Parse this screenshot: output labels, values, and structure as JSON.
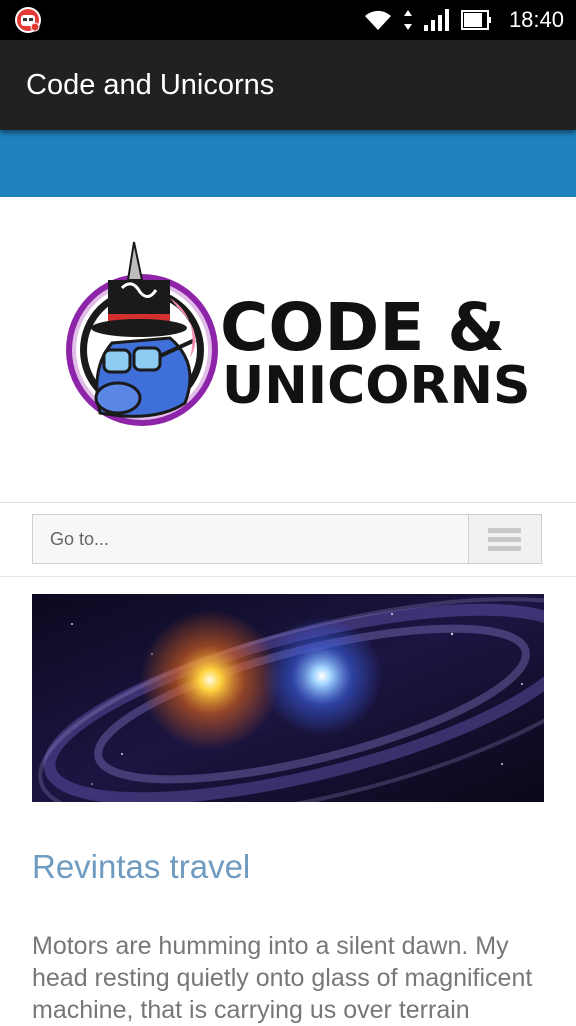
{
  "status_bar": {
    "time": "18:40",
    "icons": [
      "notification-app-icon",
      "wifi-icon",
      "data-arrows-icon",
      "signal-icon",
      "battery-icon"
    ]
  },
  "app_bar": {
    "title": "Code and Unicorns"
  },
  "colors": {
    "app_bar": "#212121",
    "accent_band": "#1e82be",
    "post_title": "#6f9bc0",
    "body_text": "#777777"
  },
  "logo": {
    "line1": "CODE &",
    "line2": "UNICORNS"
  },
  "nav": {
    "select_label": "Go to...",
    "menu_icon": "hamburger-icon"
  },
  "post": {
    "title": "Revintas travel",
    "excerpt_lines": [
      "Motors are humming into a silent dawn. My",
      "head resting quietly onto glass of magnificent",
      "machine, that is carrying us over terrain"
    ]
  }
}
